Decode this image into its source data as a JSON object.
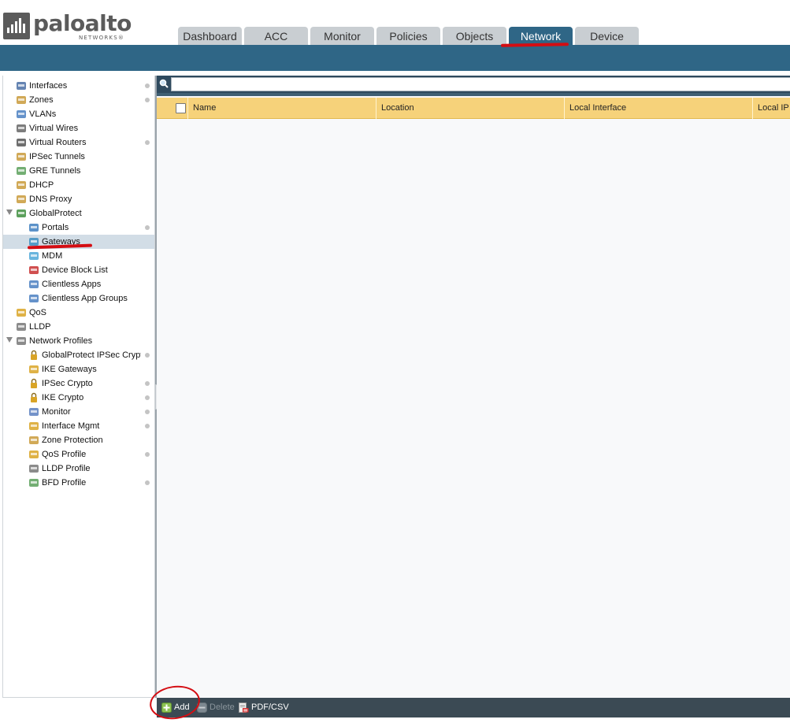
{
  "header": {
    "logo_word": "paloalto",
    "logo_sub": "NETWORKS®",
    "tabs": [
      {
        "label": "Dashboard",
        "active": false
      },
      {
        "label": "ACC",
        "active": false
      },
      {
        "label": "Monitor",
        "active": false
      },
      {
        "label": "Policies",
        "active": false
      },
      {
        "label": "Objects",
        "active": false
      },
      {
        "label": "Network",
        "active": true
      },
      {
        "label": "Device",
        "active": false
      }
    ]
  },
  "sidebar": {
    "items": [
      {
        "label": "Interfaces",
        "icon": "interfaces-icon",
        "dot": true
      },
      {
        "label": "Zones",
        "icon": "zones-icon",
        "dot": true
      },
      {
        "label": "VLANs",
        "icon": "vlans-icon",
        "dot": false
      },
      {
        "label": "Virtual Wires",
        "icon": "virtual-wires-icon",
        "dot": false
      },
      {
        "label": "Virtual Routers",
        "icon": "virtual-routers-icon",
        "dot": true
      },
      {
        "label": "IPSec Tunnels",
        "icon": "ipsec-tunnels-icon",
        "dot": false
      },
      {
        "label": "GRE Tunnels",
        "icon": "gre-tunnels-icon",
        "dot": false
      },
      {
        "label": "DHCP",
        "icon": "dhcp-icon",
        "dot": false
      },
      {
        "label": "DNS Proxy",
        "icon": "dns-proxy-icon",
        "dot": false
      },
      {
        "label": "GlobalProtect",
        "icon": "globalprotect-icon",
        "dot": false,
        "expanded": true
      },
      {
        "label": "Portals",
        "icon": "portals-icon",
        "dot": true
      },
      {
        "label": "Gateways",
        "icon": "gateways-icon",
        "dot": false,
        "selected": true
      },
      {
        "label": "MDM",
        "icon": "mdm-icon",
        "dot": false
      },
      {
        "label": "Device Block List",
        "icon": "device-block-list-icon",
        "dot": false
      },
      {
        "label": "Clientless Apps",
        "icon": "clientless-apps-icon",
        "dot": false
      },
      {
        "label": "Clientless App Groups",
        "icon": "clientless-app-groups-icon",
        "dot": false
      },
      {
        "label": "QoS",
        "icon": "qos-icon",
        "dot": false
      },
      {
        "label": "LLDP",
        "icon": "lldp-icon",
        "dot": false
      },
      {
        "label": "Network Profiles",
        "icon": "network-profiles-icon",
        "dot": false,
        "expanded": true
      },
      {
        "label": "GlobalProtect IPSec Crypto",
        "icon": "lock-icon",
        "dot": true
      },
      {
        "label": "IKE Gateways",
        "icon": "ike-gateways-icon",
        "dot": false
      },
      {
        "label": "IPSec Crypto",
        "icon": "lock-icon",
        "dot": true
      },
      {
        "label": "IKE Crypto",
        "icon": "lock-icon",
        "dot": true
      },
      {
        "label": "Monitor",
        "icon": "monitor-profile-icon",
        "dot": true
      },
      {
        "label": "Interface Mgmt",
        "icon": "interface-mgmt-icon",
        "dot": true
      },
      {
        "label": "Zone Protection",
        "icon": "zone-protection-icon",
        "dot": false
      },
      {
        "label": "QoS Profile",
        "icon": "qos-profile-icon",
        "dot": true
      },
      {
        "label": "LLDP Profile",
        "icon": "lldp-profile-icon",
        "dot": false
      },
      {
        "label": "BFD Profile",
        "icon": "bfd-profile-icon",
        "dot": true
      }
    ]
  },
  "main": {
    "search": {
      "value": "",
      "placeholder": ""
    },
    "columns": [
      "Name",
      "Location",
      "Local Interface",
      "Local IP"
    ]
  },
  "toolbar": {
    "add_label": "Add",
    "delete_label": "Delete",
    "pdf_label": "PDF/CSV"
  },
  "colors": {
    "brand_blue": "#2f6686",
    "header_yellow": "#f6d27a",
    "annotation_red": "#d40d12"
  }
}
